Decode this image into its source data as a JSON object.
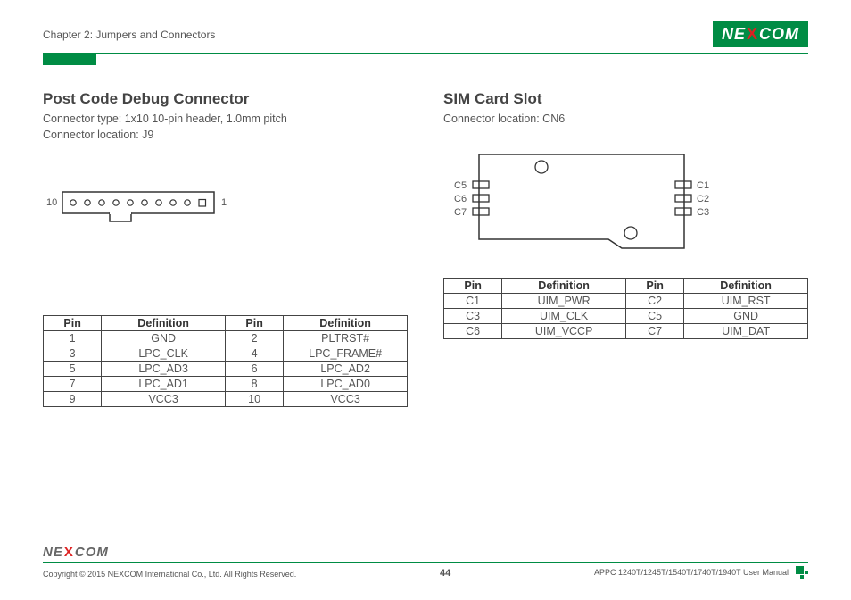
{
  "header": {
    "chapter": "Chapter 2: Jumpers and Connectors",
    "brand_pre": "NE",
    "brand_x": "X",
    "brand_post": "COM"
  },
  "left": {
    "title": "Post Code Debug Connector",
    "line1": "Connector type: 1x10 10-pin header, 1.0mm pitch",
    "line2": "Connector location: J9",
    "pin_left_label": "10",
    "pin_right_label": "1",
    "table": {
      "h_pin": "Pin",
      "h_def": "Definition",
      "rows": [
        {
          "p1": "1",
          "d1": "GND",
          "p2": "2",
          "d2": "PLTRST#"
        },
        {
          "p1": "3",
          "d1": "LPC_CLK",
          "p2": "4",
          "d2": "LPC_FRAME#"
        },
        {
          "p1": "5",
          "d1": "LPC_AD3",
          "p2": "6",
          "d2": "LPC_AD2"
        },
        {
          "p1": "7",
          "d1": "LPC_AD1",
          "p2": "8",
          "d2": "LPC_AD0"
        },
        {
          "p1": "9",
          "d1": "VCC3",
          "p2": "10",
          "d2": "VCC3"
        }
      ]
    }
  },
  "right": {
    "title": "SIM Card Slot",
    "line1": "Connector location: CN6",
    "labels": {
      "c1": "C1",
      "c2": "C2",
      "c3": "C3",
      "c5": "C5",
      "c6": "C6",
      "c7": "C7"
    },
    "table": {
      "h_pin": "Pin",
      "h_def": "Definition",
      "rows": [
        {
          "p1": "C1",
          "d1": "UIM_PWR",
          "p2": "C2",
          "d2": "UIM_RST"
        },
        {
          "p1": "C3",
          "d1": "UIM_CLK",
          "p2": "C5",
          "d2": "GND"
        },
        {
          "p1": "C6",
          "d1": "UIM_VCCP",
          "p2": "C7",
          "d2": "UIM_DAT"
        }
      ]
    }
  },
  "footer": {
    "copyright": "Copyright © 2015 NEXCOM International Co., Ltd. All Rights Reserved.",
    "page": "44",
    "manual": "APPC 1240T/1245T/1540T/1740T/1940T User Manual"
  }
}
